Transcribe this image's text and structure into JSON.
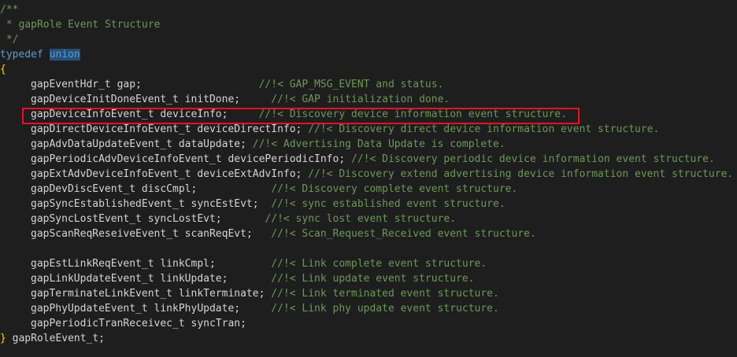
{
  "comment_block": {
    "open": "/**",
    "text": " * gapRole Event Structure",
    "close": " */"
  },
  "decl": {
    "keyword1": "typedef",
    "keyword2": "union",
    "open_brace": "{",
    "close_brace": "}",
    "close_name": " gapRoleEvent_t;"
  },
  "members": [
    {
      "code": "gapEventHdr_t gap;                   ",
      "comment": "//!< GAP_MSG_EVENT and status."
    },
    {
      "code": "gapDeviceInitDoneEvent_t initDone;     ",
      "comment": "//!< GAP initialization done."
    },
    {
      "code": "gapDeviceInfoEvent_t deviceInfo;     ",
      "comment": "//!< Discovery device information event structure."
    },
    {
      "code": "gapDirectDeviceInfoEvent_t deviceDirectInfo; ",
      "comment": "//!< Discovery direct device information event structure."
    },
    {
      "code": "gapAdvDataUpdateEvent_t dataUpdate; ",
      "comment": "//!< Advertising Data Update is complete."
    },
    {
      "code": "gapPeriodicAdvDeviceInfoEvent_t devicePeriodicInfo; ",
      "comment": "//!< Discovery periodic device information event structure."
    },
    {
      "code": "gapExtAdvDeviceInfoEvent_t deviceExtAdvInfo; ",
      "comment": "//!< Discovery extend advertising device information event structure."
    },
    {
      "code": "gapDevDiscEvent_t discCmpl;            ",
      "comment": "//!< Discovery complete event structure."
    },
    {
      "code": "gapSyncEstablishedEvent_t syncEstEvt;  ",
      "comment": "//!< sync established event structure."
    },
    {
      "code": "gapSyncLostEvent_t syncLostEvt;       ",
      "comment": "//!< sync lost event structure."
    },
    {
      "code": "gapScanReqReseiveEvent_t scanReqEvt;   ",
      "comment": "//!< Scan_Request_Received event structure."
    },
    {
      "code": "",
      "comment": ""
    },
    {
      "code": "gapEstLinkReqEvent_t linkCmpl;         ",
      "comment": "//!< Link complete event structure."
    },
    {
      "code": "gapLinkUpdateEvent_t linkUpdate;       ",
      "comment": "//!< Link update event structure."
    },
    {
      "code": "gapTerminateLinkEvent_t linkTerminate; ",
      "comment": "//!< Link terminated event structure."
    },
    {
      "code": "gapPhyUpdateEvent_t linkPhyUpdate;     ",
      "comment": "//!< Link phy update event structure."
    },
    {
      "code": "gapPeriodicTranReceivec_t syncTran;",
      "comment": ""
    }
  ],
  "colors": {
    "background": "#1e1e1e",
    "comment": "#6a9955",
    "keyword": "#569cd6",
    "highlight_box": "#e81123"
  }
}
